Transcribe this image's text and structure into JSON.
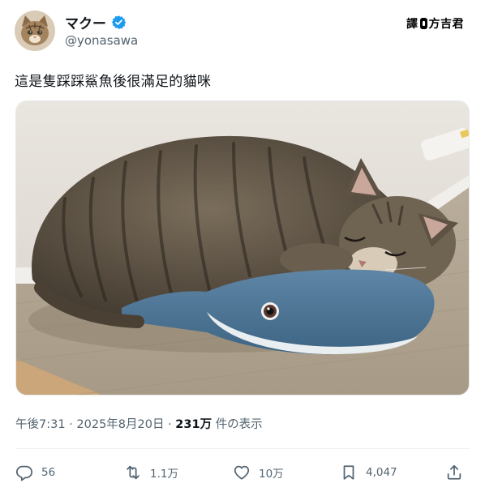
{
  "author": {
    "display_name": "マクー",
    "handle": "@yonasawa",
    "avatar_icon": "cat-avatar-icon",
    "verified_icon": "verified-badge-icon"
  },
  "credit": {
    "text": "譯",
    "name": "方吉君"
  },
  "post": {
    "text": "這是隻踩踩鯊魚後很滿足的貓咪"
  },
  "meta": {
    "time": "午後7:31",
    "date": "2025年8月20日",
    "views_count": "231万",
    "views_label": "件の表示"
  },
  "actions": {
    "reply_count": "56",
    "repost_count": "1.1万",
    "like_count": "10万",
    "bookmark_count": "4,047"
  },
  "colors": {
    "text_primary": "#0f1419",
    "text_secondary": "#536471",
    "verified": "#1d9bf0"
  }
}
